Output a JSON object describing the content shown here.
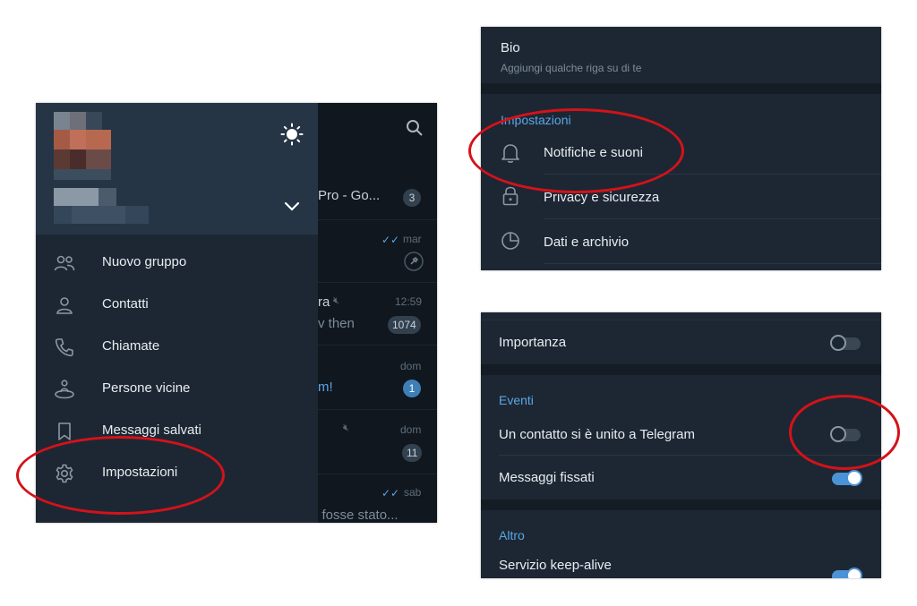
{
  "left_panel": {
    "drawer": {
      "theme_icon": "sun-icon",
      "expand_icon": "chevron-down-icon",
      "menu": [
        {
          "label": "Nuovo gruppo",
          "icon": "group-icon"
        },
        {
          "label": "Contatti",
          "icon": "person-icon"
        },
        {
          "label": "Chiamate",
          "icon": "phone-icon"
        },
        {
          "label": "Persone vicine",
          "icon": "nearby-people-icon"
        },
        {
          "label": "Messaggi salvati",
          "icon": "bookmark-icon"
        },
        {
          "label": "Impostazioni",
          "icon": "gear-icon"
        }
      ]
    },
    "chat_list": {
      "search_icon": "search-icon",
      "rows": [
        {
          "text": "Pro - Go...",
          "badge": "3"
        },
        {
          "time": "mar"
        },
        {
          "text": "ra",
          "time": "12:59"
        },
        {
          "text": "v then",
          "badge": "1074"
        },
        {
          "time": "dom"
        },
        {
          "text": "m!",
          "badge": "1"
        },
        {
          "time": "dom"
        },
        {
          "badge": "11"
        },
        {
          "time": "sab"
        },
        {
          "text": "o fosse stato..."
        }
      ]
    }
  },
  "top_right_panel": {
    "bio_title": "Bio",
    "bio_hint": "Aggiungi qualche riga su di te",
    "section_title": "Impostazioni",
    "items": [
      {
        "label": "Notifiche e suoni",
        "icon": "bell-icon"
      },
      {
        "label": "Privacy e sicurezza",
        "icon": "lock-icon"
      },
      {
        "label": "Dati e archivio",
        "icon": "pie-chart-icon"
      }
    ]
  },
  "bottom_right_panel": {
    "importance_label": "Importanza",
    "importance_on": false,
    "events_title": "Eventi",
    "events": [
      {
        "label": "Un contatto si è unito a Telegram",
        "on": false
      },
      {
        "label": "Messaggi fissati",
        "on": true
      }
    ],
    "other_title": "Altro",
    "other": [
      {
        "label": "Servizio keep-alive",
        "on": true
      }
    ]
  },
  "colors": {
    "accent": "#5aa7e6",
    "panel_background": "#1d2733",
    "annotation_ring": "#d4121a"
  }
}
